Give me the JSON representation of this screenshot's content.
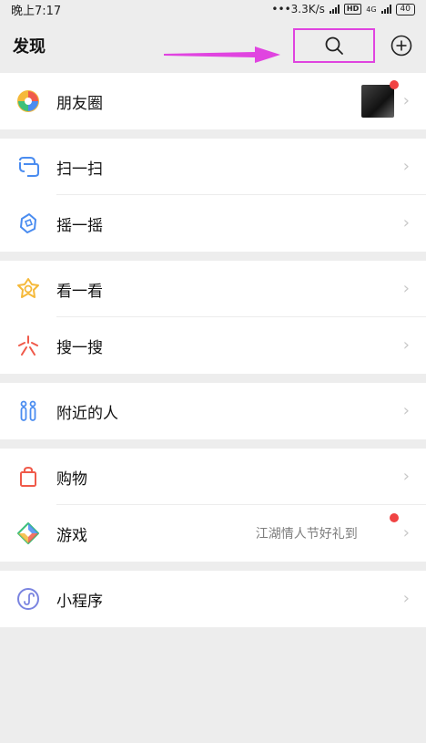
{
  "status_bar": {
    "time": "晚上7:17",
    "speed": "•••3.3K/s",
    "hd": "HD",
    "net": "4G",
    "battery": "40"
  },
  "header": {
    "title": "发现"
  },
  "sections": [
    {
      "items": [
        {
          "label": "朋友圈",
          "icon": "moments-icon"
        }
      ]
    },
    {
      "items": [
        {
          "label": "扫一扫",
          "icon": "scan-icon"
        },
        {
          "label": "摇一摇",
          "icon": "shake-icon"
        }
      ]
    },
    {
      "items": [
        {
          "label": "看一看",
          "icon": "top-stories-icon"
        },
        {
          "label": "搜一搜",
          "icon": "search-search-icon"
        }
      ]
    },
    {
      "items": [
        {
          "label": "附近的人",
          "icon": "people-nearby-icon"
        }
      ]
    },
    {
      "items": [
        {
          "label": "购物",
          "icon": "shopping-icon"
        },
        {
          "label": "游戏",
          "icon": "games-icon",
          "subtext": "江湖情人节好礼到"
        }
      ]
    },
    {
      "items": [
        {
          "label": "小程序",
          "icon": "mini-programs-icon"
        }
      ]
    }
  ],
  "colors": {
    "highlight": "#e044e0",
    "badge": "#f04343",
    "background": "#ededed"
  }
}
